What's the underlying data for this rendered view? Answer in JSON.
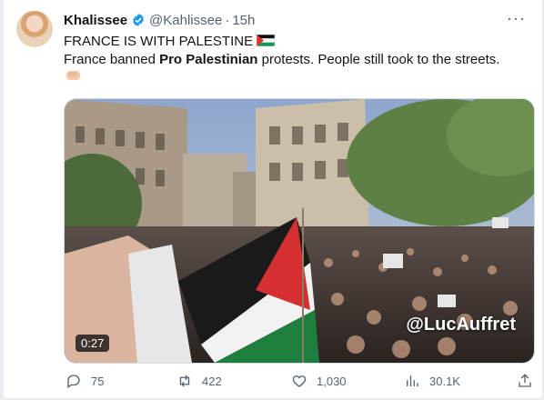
{
  "tweet": {
    "author_name": "Khalissee",
    "handle": "@Kahlissee",
    "separator": "·",
    "time": "15h",
    "more_label": "···",
    "line1": "FRANCE IS WITH PALESTINE",
    "line2_pre": "France banned ",
    "line2_bold": "Pro Palestinian",
    "line2_post": " protests. People still took to the streets."
  },
  "media": {
    "duration": "0:27",
    "watermark": "@LucAuffret"
  },
  "actions": {
    "replies": "75",
    "retweets": "422",
    "likes": "1,030",
    "views": "30.1K"
  },
  "colors": {
    "verified": "#1d9bf0",
    "text_secondary": "#536471"
  },
  "icons": [
    "verified-badge-icon",
    "more-icon",
    "palestine-flag-emoji",
    "fist-emoji",
    "reply-icon",
    "retweet-icon",
    "like-icon",
    "views-icon",
    "share-icon"
  ]
}
